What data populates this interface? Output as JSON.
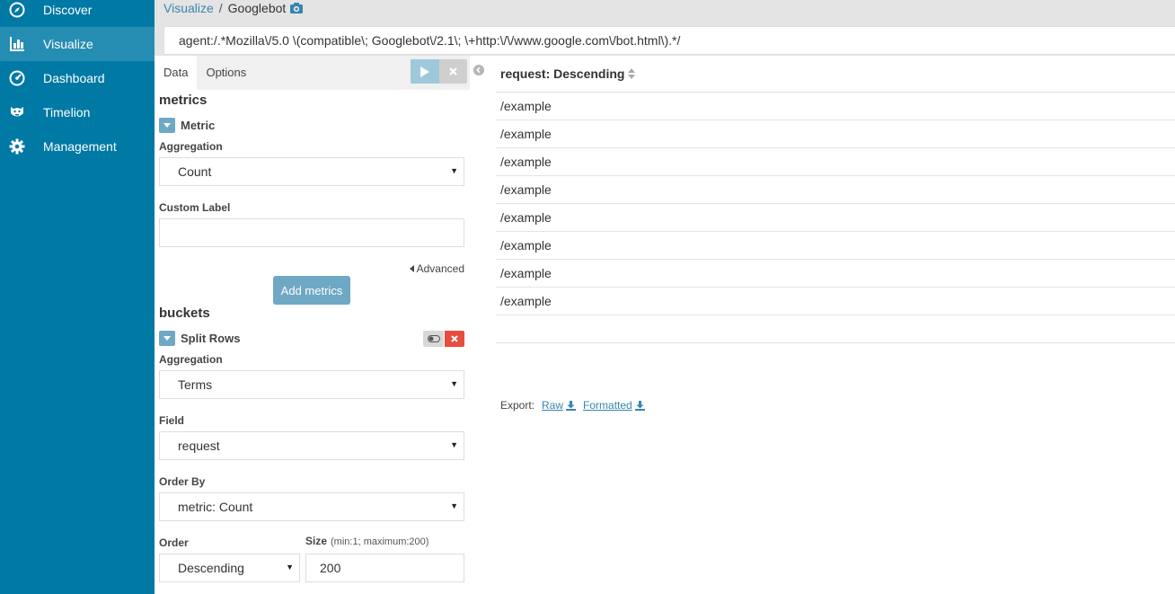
{
  "sidebar": {
    "items": [
      {
        "label": "Discover",
        "icon": "compass-icon"
      },
      {
        "label": "Visualize",
        "icon": "bar-chart-icon",
        "active": true
      },
      {
        "label": "Dashboard",
        "icon": "dashboard-icon"
      },
      {
        "label": "Timelion",
        "icon": "timelion-icon"
      },
      {
        "label": "Management",
        "icon": "gear-icon"
      }
    ]
  },
  "header": {
    "breadcrumb_link": "Visualize",
    "breadcrumb_sep": "/",
    "title": "Googlebot",
    "query": "agent:/.*Mozilla\\/5.0 \\(compatible\\; Googlebot\\/2.1\\; \\+http:\\/\\/www.google.com\\/bot.html\\).*/"
  },
  "editor": {
    "tabs": [
      "Data",
      "Options"
    ],
    "metrics": {
      "title": "metrics",
      "agg_title": "Metric",
      "aggregation_label": "Aggregation",
      "aggregation_value": "Count",
      "custom_label": "Custom Label",
      "custom_label_value": "",
      "advanced": "Advanced",
      "add_button": "Add metrics"
    },
    "buckets": {
      "title": "buckets",
      "agg_title": "Split Rows",
      "aggregation_label": "Aggregation",
      "aggregation_value": "Terms",
      "field_label": "Field",
      "field_value": "request",
      "order_by_label": "Order By",
      "order_by_value": "metric: Count",
      "order_label": "Order",
      "order_value": "Descending",
      "size_label": "Size",
      "size_hint": "(min:1; maximum:200)",
      "size_value": "200"
    }
  },
  "results": {
    "column_header": "request: Descending",
    "rows": [
      "/example",
      "/example",
      "/example",
      "/example",
      "/example",
      "/example",
      "/example",
      "/example"
    ],
    "export_label": "Export:",
    "export_raw": "Raw",
    "export_formatted": "Formatted"
  },
  "colors": {
    "sidebar_bg": "#0079a5",
    "accent": "#6fa8c4",
    "link": "#3785b0",
    "danger": "#e74c3c"
  }
}
